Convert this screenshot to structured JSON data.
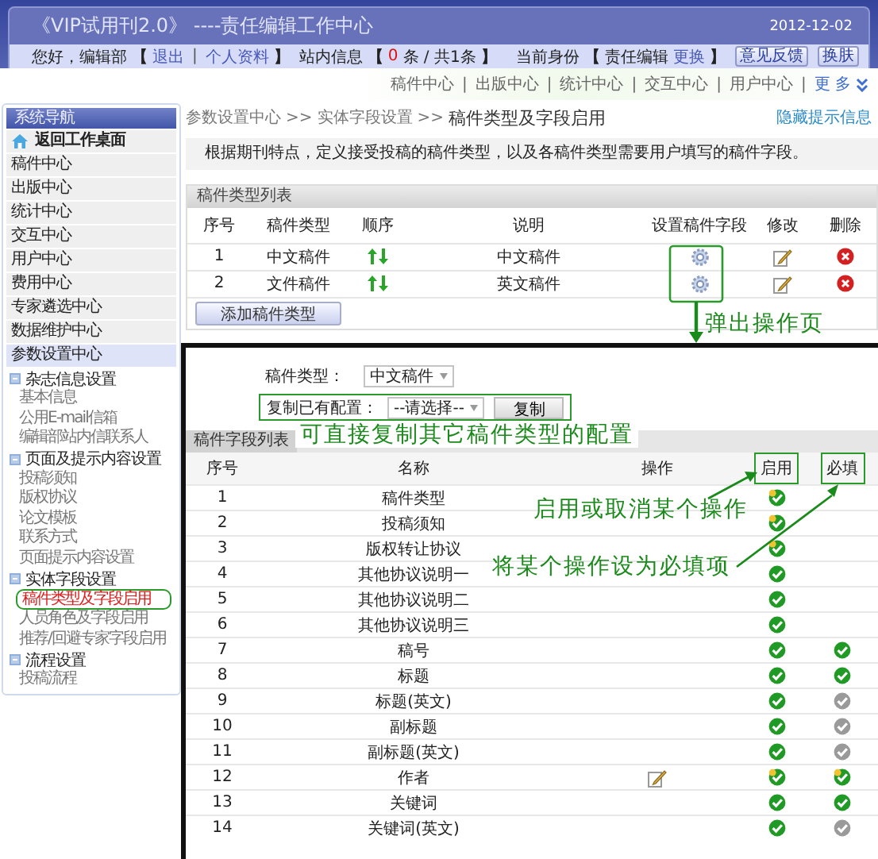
{
  "header": {
    "title": "《VIP试用刊2.0》 ----责任编辑工作中心",
    "date": "2012-12-02"
  },
  "user_bar": {
    "greeting": "您好，编辑部",
    "bracket_open": "【",
    "links": [
      {
        "label": "退出"
      },
      {
        "label": "个人资料"
      }
    ],
    "separator": "|",
    "bracket_close": "】"
  },
  "messages": {
    "label": "站内信息",
    "bracket_open": "【",
    "unread": "0",
    "rest": "条 / 共1条",
    "bracket_close": "】"
  },
  "identity": {
    "label": "当前身份",
    "bracket_open": "【",
    "role": "责任编辑",
    "change": "更换",
    "bracket_close": "】"
  },
  "header_buttons": [
    "意见反馈",
    "换肤"
  ],
  "top_nav": {
    "items": [
      {
        "label": "稿件中心"
      },
      {
        "label": "出版中心"
      },
      {
        "label": "统计中心"
      },
      {
        "label": "交互中心"
      },
      {
        "label": "用户中心"
      }
    ],
    "separators": [
      "|",
      "|",
      "|",
      "|",
      "|"
    ],
    "more": "更 多"
  },
  "sidebar": {
    "title": "系统导航",
    "home": "返回工作桌面",
    "centers": [
      {
        "label": "稿件中心",
        "selected": false
      },
      {
        "label": "出版中心",
        "selected": false
      },
      {
        "label": "统计中心",
        "selected": false
      },
      {
        "label": "交互中心",
        "selected": false
      },
      {
        "label": "用户中心",
        "selected": false
      },
      {
        "label": "费用中心",
        "selected": false
      },
      {
        "label": "专家遴选中心",
        "selected": false
      },
      {
        "label": "数据维护中心",
        "selected": false
      },
      {
        "label": "参数设置中心",
        "selected": true
      }
    ],
    "groups": [
      {
        "label": "杂志信息设置",
        "children": [
          {
            "label": "基本信息",
            "selected": false
          },
          {
            "label": "公用E-mail信箱",
            "selected": false
          },
          {
            "label": "编辑部站内信联系人",
            "selected": false
          }
        ]
      },
      {
        "label": "页面及提示内容设置",
        "children": [
          {
            "label": "投稿须知",
            "selected": false
          },
          {
            "label": "版权协议",
            "selected": false
          },
          {
            "label": "论文模板",
            "selected": false
          },
          {
            "label": "联系方式",
            "selected": false
          },
          {
            "label": "页面提示内容设置",
            "selected": false
          }
        ]
      },
      {
        "label": "实体字段设置",
        "children": [
          {
            "label": "稿件类型及字段启用",
            "selected": true
          },
          {
            "label": "人员角色及字段启用",
            "selected": false
          },
          {
            "label": "推荐/回避专家字段启用",
            "selected": false
          }
        ]
      },
      {
        "label": "流程设置",
        "children": [
          {
            "label": "投稿流程",
            "selected": false
          }
        ]
      }
    ]
  },
  "breadcrumb": {
    "crumbs": [
      {
        "label": "参数设置中心",
        "sep": ">>"
      },
      {
        "label": "实体字段设置",
        "sep": ">>"
      }
    ],
    "current": "稿件类型及字段启用",
    "hide_link": "隐藏提示信息"
  },
  "hint": "根据期刊特点，定义接受投稿的稿件类型，以及各稿件类型需要用户填写的稿件字段。",
  "type_table": {
    "title": "稿件类型列表",
    "columns": [
      "序号",
      "稿件类型",
      "顺序",
      "说明",
      "设置稿件字段",
      "修改",
      "删除"
    ],
    "rows": [
      {
        "no": "1",
        "type": "中文稿件",
        "desc": "中文稿件"
      },
      {
        "no": "2",
        "type": "文件稿件",
        "desc": "英文稿件"
      }
    ],
    "add_button": "添加稿件类型"
  },
  "popup": {
    "type_label": "稿件类型：",
    "type_value": "中文稿件",
    "copy_label": "复制已有配置：",
    "copy_value": "--请选择--",
    "copy_button": "复制",
    "tab": "稿件字段列表",
    "columns": [
      {
        "label": "序号",
        "highlighted": false
      },
      {
        "label": "名称",
        "highlighted": false
      },
      {
        "label": "操作",
        "highlighted": false
      },
      {
        "label": "启用",
        "highlighted": true
      },
      {
        "label": "必填",
        "highlighted": true
      }
    ],
    "rows": [
      {
        "no": "1",
        "name": "稿件类型",
        "editable": false,
        "enabled": {
          "checked": true,
          "fixed": true
        }
      },
      {
        "no": "2",
        "name": "投稿须知",
        "editable": false,
        "enabled": {
          "checked": true,
          "fixed": true
        }
      },
      {
        "no": "3",
        "name": "版权转让协议",
        "editable": false,
        "enabled": {
          "checked": true,
          "fixed": true
        }
      },
      {
        "no": "4",
        "name": "其他协议说明一",
        "editable": false,
        "enabled": {
          "checked": true,
          "fixed": false
        }
      },
      {
        "no": "5",
        "name": "其他协议说明二",
        "editable": false,
        "enabled": {
          "checked": true,
          "fixed": false
        }
      },
      {
        "no": "6",
        "name": "其他协议说明三",
        "editable": false,
        "enabled": {
          "checked": true,
          "fixed": false
        }
      },
      {
        "no": "7",
        "name": "稿号",
        "editable": false,
        "enabled": {
          "checked": true,
          "fixed": false
        },
        "required": {
          "checked": true,
          "fixed": false
        }
      },
      {
        "no": "8",
        "name": "标题",
        "editable": false,
        "enabled": {
          "checked": true,
          "fixed": false
        },
        "required": {
          "checked": true,
          "fixed": false
        }
      },
      {
        "no": "9",
        "name": "标题(英文)",
        "editable": false,
        "enabled": {
          "checked": true,
          "fixed": false
        },
        "required": {
          "checked": false,
          "fixed": false
        }
      },
      {
        "no": "10",
        "name": "副标题",
        "editable": false,
        "enabled": {
          "checked": true,
          "fixed": false
        },
        "required": {
          "checked": false,
          "fixed": false
        }
      },
      {
        "no": "11",
        "name": "副标题(英文)",
        "editable": false,
        "enabled": {
          "checked": true,
          "fixed": false
        },
        "required": {
          "checked": false,
          "fixed": false
        }
      },
      {
        "no": "12",
        "name": "作者",
        "editable": true,
        "enabled": {
          "checked": true,
          "fixed": true
        },
        "required": {
          "checked": true,
          "fixed": true
        }
      },
      {
        "no": "13",
        "name": "关键词",
        "editable": false,
        "enabled": {
          "checked": true,
          "fixed": false
        },
        "required": {
          "checked": true,
          "fixed": false
        }
      },
      {
        "no": "14",
        "name": "关键词(英文)",
        "editable": false,
        "enabled": {
          "checked": true,
          "fixed": false
        },
        "required": {
          "checked": false,
          "fixed": false
        }
      }
    ]
  },
  "annotations": {
    "popup": "弹出操作页",
    "copy": "可直接复制其它稿件类型的配置",
    "enable": "启用或取消某个操作",
    "required": "将某个操作设为必填项"
  }
}
